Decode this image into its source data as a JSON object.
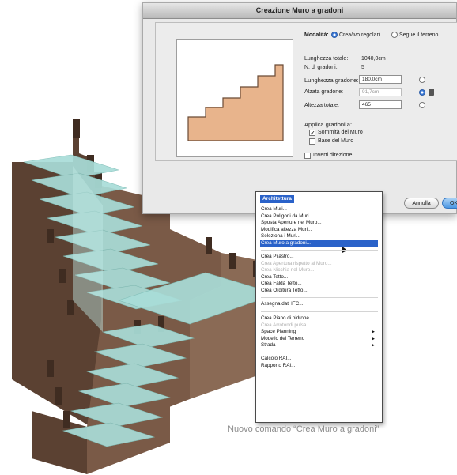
{
  "dialog": {
    "title": "Creazione Muro a gradoni",
    "modalita_label": "Modalità:",
    "modalita_options": [
      "Crea/ivo regolari",
      "Segue il terreno"
    ],
    "fields": [
      {
        "label": "Lunghezza totale:",
        "value": "1040,0cm"
      },
      {
        "label": "N. di gradoni:",
        "value": "5"
      },
      {
        "label": "Lunghezza gradone:",
        "value": "180,0cm"
      },
      {
        "label": "Alzata gradone:",
        "value": "91,7cm"
      },
      {
        "label": "Altezza totale:",
        "value": "465"
      }
    ],
    "applica_label": "Applica gradoni a:",
    "checkboxes": [
      {
        "label": "Sommità del Muro",
        "checked": true
      },
      {
        "label": "Base del Muro",
        "checked": false
      },
      {
        "label": "Inverti direzione",
        "checked": false
      }
    ],
    "buttons": {
      "cancel": "Annulla",
      "ok": "OK"
    },
    "preview_fill": "#e8b48c"
  },
  "menu": {
    "title": "Architettura",
    "groups": [
      [
        {
          "label": "Crea Muri..."
        },
        {
          "label": "Crea Poligoni da Muri..."
        },
        {
          "label": "Sposta Aperture nel Muro..."
        },
        {
          "label": "Modifica altezza Muri..."
        },
        {
          "label": "Seleziona i Muri..."
        },
        {
          "label": "Crea Muro a gradoni...",
          "selected": true
        }
      ],
      [
        {
          "label": "Crea Pilastro..."
        },
        {
          "label": "Crea Apertura rispetto al Muro...",
          "disabled": true
        },
        {
          "label": "Crea Nicchia nel Muro...",
          "disabled": true
        },
        {
          "label": "Crea Tetto..."
        },
        {
          "label": "Crea Falda Tetto..."
        },
        {
          "label": "Crea Orditura Tetto..."
        }
      ],
      [
        {
          "label": "Assegna dati IFC..."
        }
      ],
      [
        {
          "label": "Crea Piano di pidrone..."
        },
        {
          "label": "Crea Arrotondi pulsa...",
          "disabled": true
        },
        {
          "label": "Space Planning",
          "submenu": true
        },
        {
          "label": "Modello del Terreno",
          "submenu": true
        },
        {
          "label": "Strada",
          "submenu": true
        }
      ],
      [
        {
          "label": "Calcolo RAI..."
        },
        {
          "label": "Rapporto RAI..."
        }
      ]
    ]
  },
  "caption": "Nuovo comando “Crea Muro a gradoni”",
  "colors": {
    "wall_front": "#6b4e3c",
    "wall_side": "#8a6a55",
    "glass": "#a9ddd8",
    "menu_highlight": "#2a62c9"
  }
}
